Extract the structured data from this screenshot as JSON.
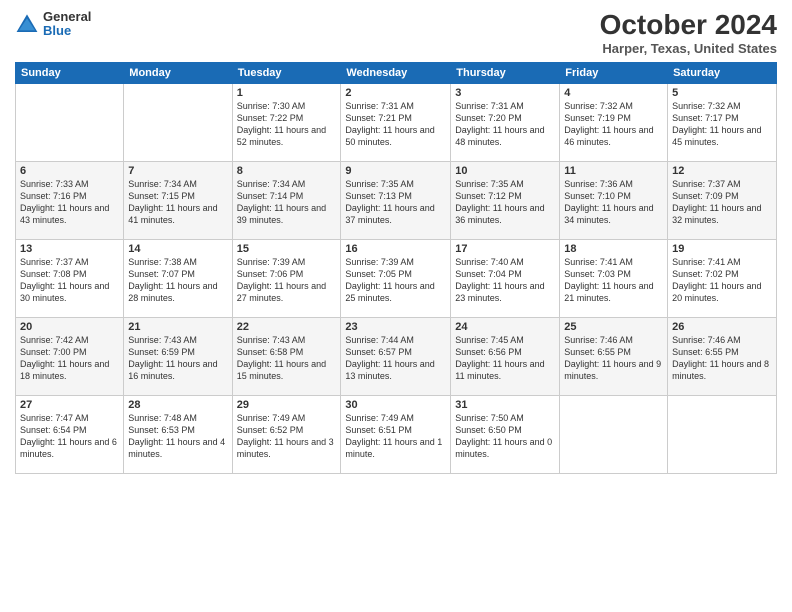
{
  "logo": {
    "general": "General",
    "blue": "Blue"
  },
  "title": "October 2024",
  "location": "Harper, Texas, United States",
  "days_header": [
    "Sunday",
    "Monday",
    "Tuesday",
    "Wednesday",
    "Thursday",
    "Friday",
    "Saturday"
  ],
  "weeks": [
    [
      {
        "day": "",
        "sunrise": "",
        "sunset": "",
        "daylight": ""
      },
      {
        "day": "",
        "sunrise": "",
        "sunset": "",
        "daylight": ""
      },
      {
        "day": "1",
        "sunrise": "Sunrise: 7:30 AM",
        "sunset": "Sunset: 7:22 PM",
        "daylight": "Daylight: 11 hours and 52 minutes."
      },
      {
        "day": "2",
        "sunrise": "Sunrise: 7:31 AM",
        "sunset": "Sunset: 7:21 PM",
        "daylight": "Daylight: 11 hours and 50 minutes."
      },
      {
        "day": "3",
        "sunrise": "Sunrise: 7:31 AM",
        "sunset": "Sunset: 7:20 PM",
        "daylight": "Daylight: 11 hours and 48 minutes."
      },
      {
        "day": "4",
        "sunrise": "Sunrise: 7:32 AM",
        "sunset": "Sunset: 7:19 PM",
        "daylight": "Daylight: 11 hours and 46 minutes."
      },
      {
        "day": "5",
        "sunrise": "Sunrise: 7:32 AM",
        "sunset": "Sunset: 7:17 PM",
        "daylight": "Daylight: 11 hours and 45 minutes."
      }
    ],
    [
      {
        "day": "6",
        "sunrise": "Sunrise: 7:33 AM",
        "sunset": "Sunset: 7:16 PM",
        "daylight": "Daylight: 11 hours and 43 minutes."
      },
      {
        "day": "7",
        "sunrise": "Sunrise: 7:34 AM",
        "sunset": "Sunset: 7:15 PM",
        "daylight": "Daylight: 11 hours and 41 minutes."
      },
      {
        "day": "8",
        "sunrise": "Sunrise: 7:34 AM",
        "sunset": "Sunset: 7:14 PM",
        "daylight": "Daylight: 11 hours and 39 minutes."
      },
      {
        "day": "9",
        "sunrise": "Sunrise: 7:35 AM",
        "sunset": "Sunset: 7:13 PM",
        "daylight": "Daylight: 11 hours and 37 minutes."
      },
      {
        "day": "10",
        "sunrise": "Sunrise: 7:35 AM",
        "sunset": "Sunset: 7:12 PM",
        "daylight": "Daylight: 11 hours and 36 minutes."
      },
      {
        "day": "11",
        "sunrise": "Sunrise: 7:36 AM",
        "sunset": "Sunset: 7:10 PM",
        "daylight": "Daylight: 11 hours and 34 minutes."
      },
      {
        "day": "12",
        "sunrise": "Sunrise: 7:37 AM",
        "sunset": "Sunset: 7:09 PM",
        "daylight": "Daylight: 11 hours and 32 minutes."
      }
    ],
    [
      {
        "day": "13",
        "sunrise": "Sunrise: 7:37 AM",
        "sunset": "Sunset: 7:08 PM",
        "daylight": "Daylight: 11 hours and 30 minutes."
      },
      {
        "day": "14",
        "sunrise": "Sunrise: 7:38 AM",
        "sunset": "Sunset: 7:07 PM",
        "daylight": "Daylight: 11 hours and 28 minutes."
      },
      {
        "day": "15",
        "sunrise": "Sunrise: 7:39 AM",
        "sunset": "Sunset: 7:06 PM",
        "daylight": "Daylight: 11 hours and 27 minutes."
      },
      {
        "day": "16",
        "sunrise": "Sunrise: 7:39 AM",
        "sunset": "Sunset: 7:05 PM",
        "daylight": "Daylight: 11 hours and 25 minutes."
      },
      {
        "day": "17",
        "sunrise": "Sunrise: 7:40 AM",
        "sunset": "Sunset: 7:04 PM",
        "daylight": "Daylight: 11 hours and 23 minutes."
      },
      {
        "day": "18",
        "sunrise": "Sunrise: 7:41 AM",
        "sunset": "Sunset: 7:03 PM",
        "daylight": "Daylight: 11 hours and 21 minutes."
      },
      {
        "day": "19",
        "sunrise": "Sunrise: 7:41 AM",
        "sunset": "Sunset: 7:02 PM",
        "daylight": "Daylight: 11 hours and 20 minutes."
      }
    ],
    [
      {
        "day": "20",
        "sunrise": "Sunrise: 7:42 AM",
        "sunset": "Sunset: 7:00 PM",
        "daylight": "Daylight: 11 hours and 18 minutes."
      },
      {
        "day": "21",
        "sunrise": "Sunrise: 7:43 AM",
        "sunset": "Sunset: 6:59 PM",
        "daylight": "Daylight: 11 hours and 16 minutes."
      },
      {
        "day": "22",
        "sunrise": "Sunrise: 7:43 AM",
        "sunset": "Sunset: 6:58 PM",
        "daylight": "Daylight: 11 hours and 15 minutes."
      },
      {
        "day": "23",
        "sunrise": "Sunrise: 7:44 AM",
        "sunset": "Sunset: 6:57 PM",
        "daylight": "Daylight: 11 hours and 13 minutes."
      },
      {
        "day": "24",
        "sunrise": "Sunrise: 7:45 AM",
        "sunset": "Sunset: 6:56 PM",
        "daylight": "Daylight: 11 hours and 11 minutes."
      },
      {
        "day": "25",
        "sunrise": "Sunrise: 7:46 AM",
        "sunset": "Sunset: 6:55 PM",
        "daylight": "Daylight: 11 hours and 9 minutes."
      },
      {
        "day": "26",
        "sunrise": "Sunrise: 7:46 AM",
        "sunset": "Sunset: 6:55 PM",
        "daylight": "Daylight: 11 hours and 8 minutes."
      }
    ],
    [
      {
        "day": "27",
        "sunrise": "Sunrise: 7:47 AM",
        "sunset": "Sunset: 6:54 PM",
        "daylight": "Daylight: 11 hours and 6 minutes."
      },
      {
        "day": "28",
        "sunrise": "Sunrise: 7:48 AM",
        "sunset": "Sunset: 6:53 PM",
        "daylight": "Daylight: 11 hours and 4 minutes."
      },
      {
        "day": "29",
        "sunrise": "Sunrise: 7:49 AM",
        "sunset": "Sunset: 6:52 PM",
        "daylight": "Daylight: 11 hours and 3 minutes."
      },
      {
        "day": "30",
        "sunrise": "Sunrise: 7:49 AM",
        "sunset": "Sunset: 6:51 PM",
        "daylight": "Daylight: 11 hours and 1 minute."
      },
      {
        "day": "31",
        "sunrise": "Sunrise: 7:50 AM",
        "sunset": "Sunset: 6:50 PM",
        "daylight": "Daylight: 11 hours and 0 minutes."
      },
      {
        "day": "",
        "sunrise": "",
        "sunset": "",
        "daylight": ""
      },
      {
        "day": "",
        "sunrise": "",
        "sunset": "",
        "daylight": ""
      }
    ]
  ]
}
